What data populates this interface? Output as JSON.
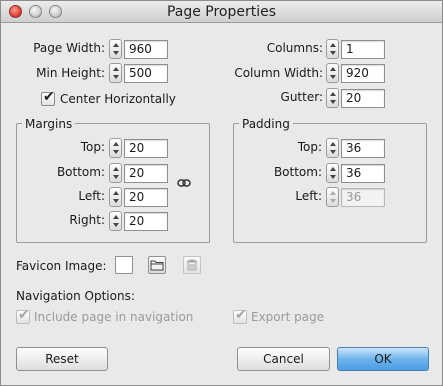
{
  "window": {
    "title": "Page Properties"
  },
  "layout_fields": {
    "page_width_label": "Page Width:",
    "page_width_value": "960",
    "min_height_label": "Min Height:",
    "min_height_value": "500",
    "columns_label": "Columns:",
    "columns_value": "1",
    "column_width_label": "Column Width:",
    "column_width_value": "920",
    "gutter_label": "Gutter:",
    "gutter_value": "20",
    "center_horizontally_label": "Center Horizontally"
  },
  "margins": {
    "title": "Margins",
    "top_label": "Top:",
    "top_value": "20",
    "bottom_label": "Bottom:",
    "bottom_value": "20",
    "left_label": "Left:",
    "left_value": "20",
    "right_label": "Right:",
    "right_value": "20"
  },
  "padding": {
    "title": "Padding",
    "top_label": "Top:",
    "top_value": "36",
    "bottom_label": "Bottom:",
    "bottom_value": "36",
    "left_label": "Left:",
    "left_value": "36"
  },
  "favicon": {
    "label": "Favicon Image:"
  },
  "navigation": {
    "heading": "Navigation Options:",
    "include_label": "Include page in navigation",
    "export_label": "Export page"
  },
  "buttons": {
    "reset": "Reset",
    "cancel": "Cancel",
    "ok": "OK"
  },
  "colors": {
    "accent": "#6eb4ec",
    "close": "#e0443a"
  }
}
